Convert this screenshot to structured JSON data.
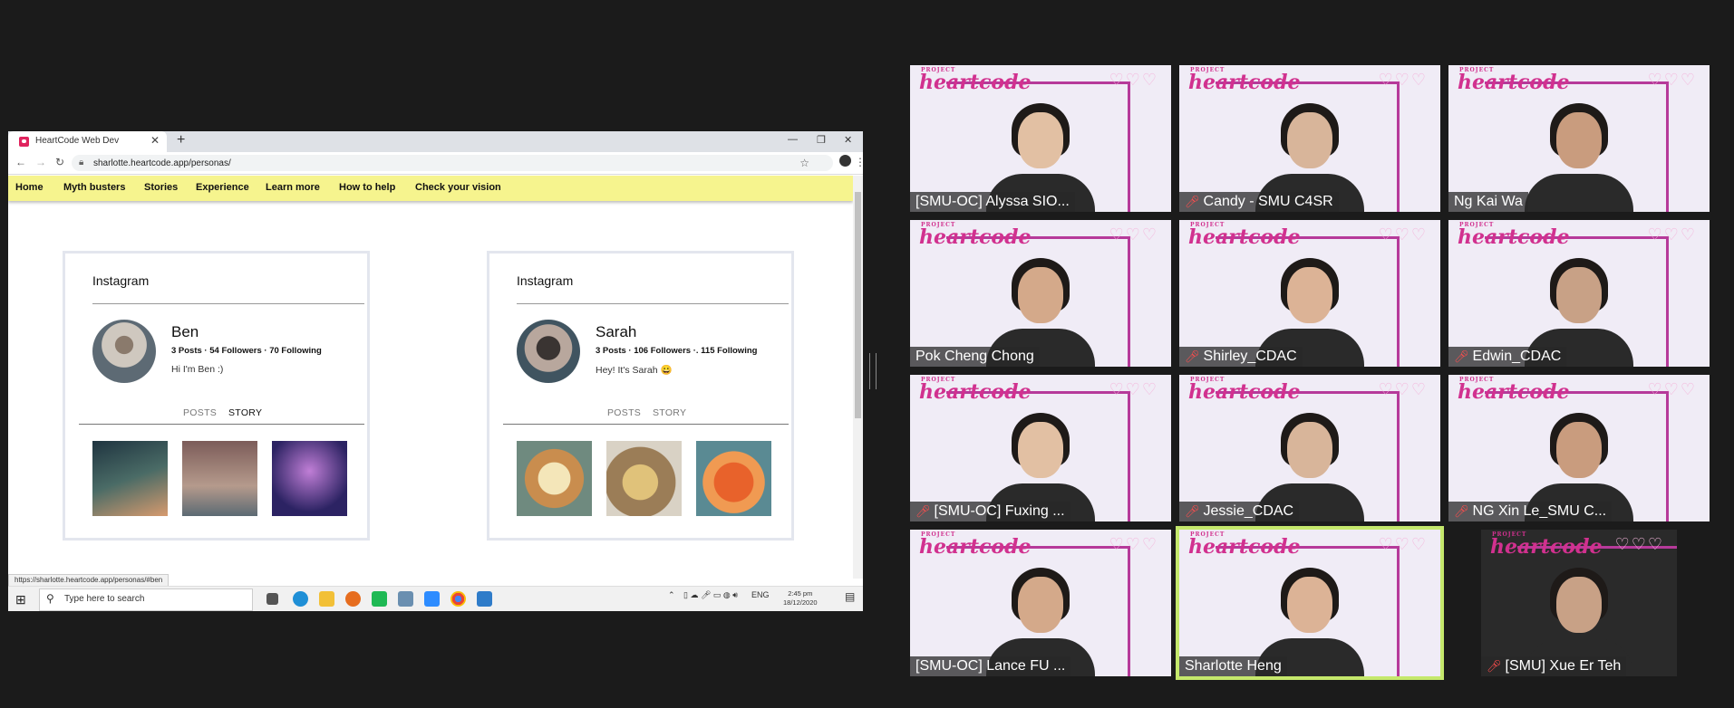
{
  "browser": {
    "tab_title": "HeartCode Web Dev",
    "url": "sharlotte.heartcode.app/personas/",
    "status_url": "https://sharlotte.heartcode.app/personas/#ben"
  },
  "nav": {
    "items": [
      "Home",
      "Myth busters",
      "Stories",
      "Experience",
      "Learn more",
      "How to help",
      "Check your vision"
    ]
  },
  "cards": [
    {
      "brand": "Instagram",
      "name": "Ben",
      "stats": "3 Posts · 54 Followers · 70 Following",
      "bio": "Hi I'm Ben :)",
      "tab_posts": "POSTS",
      "tab_story": "STORY",
      "active_tab": "STORY",
      "thumb_colors": [
        "#2b3b47",
        "#9a7f73",
        "#3a2f6e"
      ]
    },
    {
      "brand": "Instagram",
      "name": "Sarah",
      "stats": "3 Posts · 106 Followers ·. 115 Following",
      "bio": "Hey! It's Sarah 😀",
      "tab_posts": "POSTS",
      "tab_story": "STORY",
      "active_tab": "none",
      "thumb_colors": [
        "#c9955c",
        "#b99f72",
        "#d7633b"
      ]
    }
  ],
  "taskbar": {
    "search_placeholder": "Type here to search",
    "lang": "ENG",
    "time": "2:45 pm",
    "date": "18/12/2020"
  },
  "participants": [
    {
      "name": "[SMU-OC] Alyssa SIO...",
      "muted": false
    },
    {
      "name": "Candy - SMU C4SR",
      "muted": true
    },
    {
      "name": "Ng Kai Wa",
      "muted": false
    },
    {
      "name": "Pok Cheng Chong",
      "muted": false
    },
    {
      "name": "Shirley_CDAC",
      "muted": true
    },
    {
      "name": "Edwin_CDAC",
      "muted": true
    },
    {
      "name": "[SMU-OC] Fuxing ...",
      "muted": true
    },
    {
      "name": "Jessie_CDAC",
      "muted": true
    },
    {
      "name": "NG Xin Le_SMU C...",
      "muted": true
    },
    {
      "name": "[SMU-OC] Lance  FU ...",
      "muted": false
    },
    {
      "name": "Sharlotte Heng",
      "muted": false,
      "active_speaker": true
    },
    {
      "name": "[SMU] Xue Er Teh",
      "muted": true
    }
  ],
  "colors": {
    "nav_bg": "#f6f48e",
    "active_speaker": "#c5e86c",
    "brand_pink": "#d1318f"
  }
}
